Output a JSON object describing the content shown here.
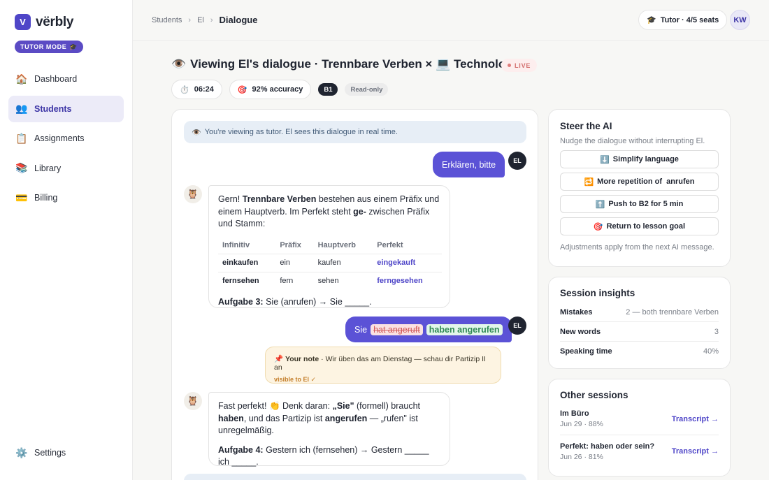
{
  "brand": {
    "mark": "V",
    "name": "vërbly",
    "mode": "TUTOR MODE",
    "mode_icon": "🎓"
  },
  "nav": {
    "items": [
      {
        "icon": "🏠",
        "label": "Dashboard"
      },
      {
        "icon": "👥",
        "label": "Students"
      },
      {
        "icon": "📋",
        "label": "Assignments"
      },
      {
        "icon": "📚",
        "label": "Library"
      },
      {
        "icon": "💳",
        "label": "Billing"
      }
    ],
    "active": "Students",
    "settings": {
      "icon": "⚙️",
      "label": "Settings"
    }
  },
  "breadcrumb": [
    "Students",
    "El",
    "Dialogue"
  ],
  "topbar": {
    "seats_icon": "🎓",
    "seats": "Tutor · 4/5 seats",
    "avatar": "KW"
  },
  "header": {
    "icon": "👁️",
    "title": "Viewing El's dialogue · Trennbare Verben × 💻 Technologie",
    "live": "LIVE",
    "timer_icon": "⏱️",
    "timer": "06:24",
    "accuracy_icon": "🎯",
    "accuracy": "92% accuracy",
    "level": "B1",
    "readonly": "Read-only"
  },
  "chat": {
    "banner_icon": "👁️",
    "banner": "You're viewing as tutor. El sees this dialogue in real time.",
    "student_initials": "EL",
    "tutor_ai_icon": "🦉",
    "msg1": "Erklären, bitte",
    "ai1": {
      "p1": "Gern!",
      "p1b": "Trennbare Verben",
      "p1c": "bestehen aus einem Präfix und einem Hauptverb. Im Perfekt steht",
      "p1d": "ge-",
      "p1e": "zwischen Präfix und Stamm:",
      "table_headers": [
        "Infinitiv",
        "Präfix",
        "Hauptverb",
        "Perfekt"
      ],
      "rows": [
        [
          "einkaufen",
          "ein",
          "kaufen",
          "eingekauft"
        ],
        [
          "fernsehen",
          "fern",
          "sehen",
          "ferngesehen"
        ]
      ],
      "task_label": "Aufgabe 3:",
      "task": "Sie (anrufen) → Sie _____."
    },
    "msg2": {
      "word": "Sie",
      "wrong": "hat angeruft",
      "right": "haben angerufen"
    },
    "note": {
      "icon": "📌",
      "label": "Your note",
      "text": "· Wir üben das am Dienstag — schau dir Partizip II an",
      "visibility": "visible to El ✓"
    },
    "ai2": {
      "p1": "Fast perfekt! 👏 Denk daran:",
      "p1b": "„Sie\"",
      "p1c": "(formell) braucht",
      "p1d": "haben",
      "p1e": ", und das Partizip ist",
      "p1f": "angerufen",
      "p1g": "— „rufen\" ist unregelmäßig.",
      "task_label": "Aufgabe 4:",
      "task": "Gestern ich (fernsehen) → Gestern _____ ich _____."
    }
  },
  "steer": {
    "title": "Steer the AI",
    "subtitle": "Nudge the dialogue without interrupting El.",
    "buttons": [
      {
        "icon": "⬇️",
        "label": "Simplify language"
      },
      {
        "icon": "🔁",
        "label": "More repetition of  anrufen"
      },
      {
        "icon": "⬆️",
        "label": "Push to B2 for 5 min"
      },
      {
        "icon": "🎯",
        "label": "Return to lesson goal"
      }
    ],
    "footer": "Adjustments apply from the next AI message."
  },
  "insights": {
    "title": "Session insights",
    "rows": [
      {
        "label": "Mistakes",
        "value": "2 — both trennbare Verben"
      },
      {
        "label": "New words",
        "value": "3"
      },
      {
        "label": "Speaking time",
        "value": "40%"
      }
    ]
  },
  "sessions": {
    "title": "Other sessions",
    "items": [
      {
        "name": "Im Büro",
        "meta": "Jun 29 · 88%",
        "link": "Transcript →"
      },
      {
        "name": "Perfekt: haben oder sein?",
        "meta": "Jun 26 · 81%",
        "link": "Transcript →"
      }
    ]
  }
}
